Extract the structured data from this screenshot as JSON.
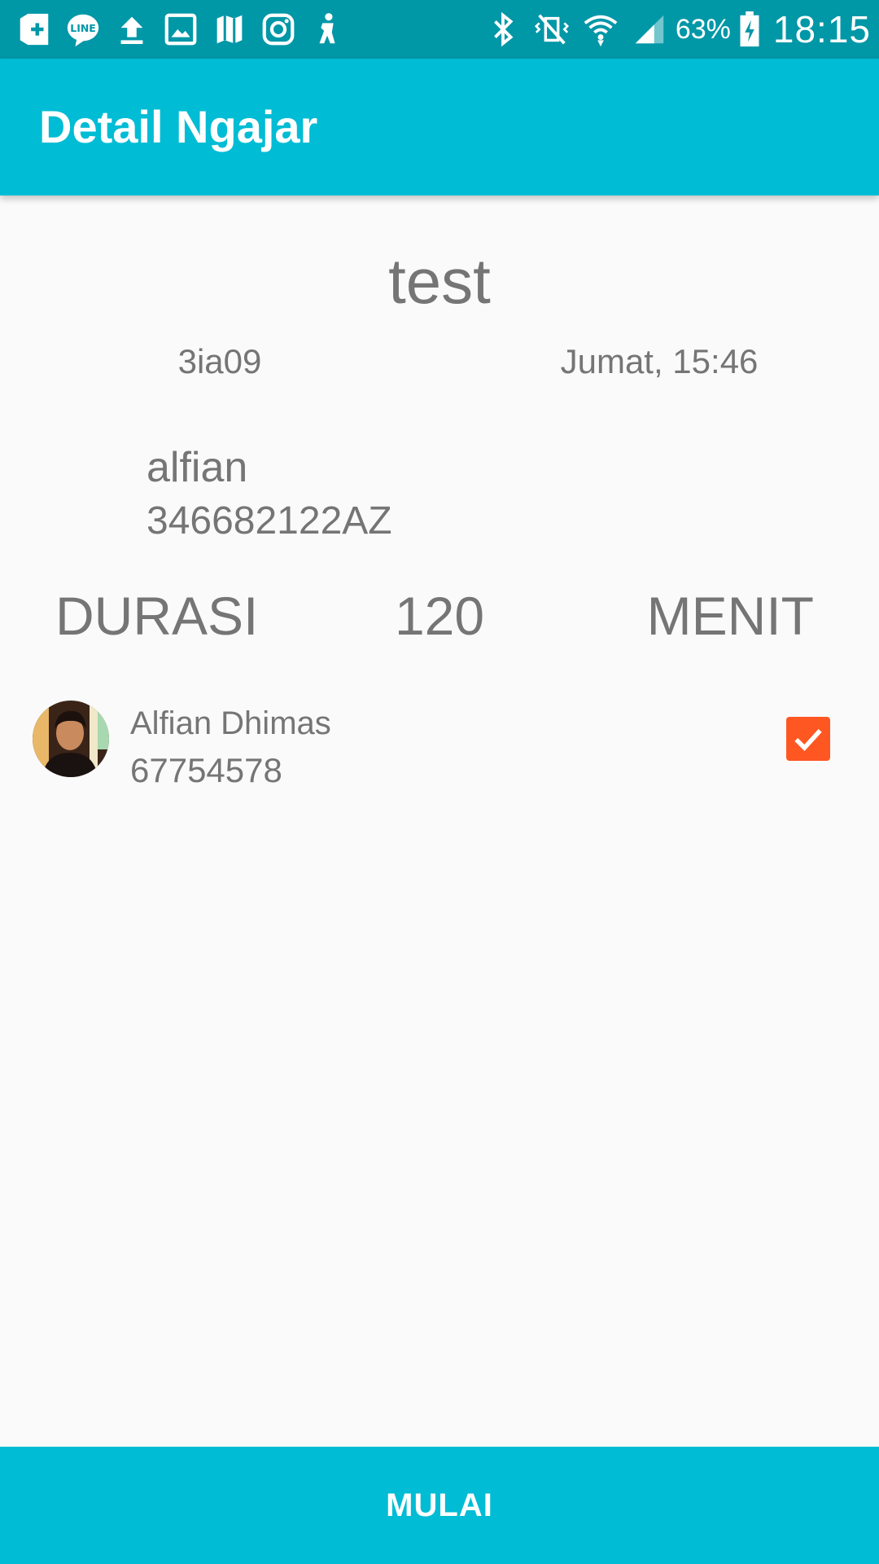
{
  "status_bar": {
    "battery_percent": "63%",
    "time": "18:15",
    "icons_left": [
      "add-box-icon",
      "line-icon",
      "upload-icon",
      "image-icon",
      "map-icon",
      "instagram-icon",
      "accessibility-icon"
    ],
    "icons_right": [
      "bluetooth-icon",
      "vibrate-off-icon",
      "wifi-icon",
      "signal-icon",
      "battery-charging-icon"
    ]
  },
  "app_bar": {
    "title": "Detail Ngajar"
  },
  "course": {
    "title": "test",
    "class_code": "3ia09",
    "schedule": "Jumat, 15:46"
  },
  "lecturer": {
    "name": "alfian",
    "id": "346682122AZ"
  },
  "duration": {
    "label": "DURASI",
    "value": "120",
    "unit": "MENIT"
  },
  "students": [
    {
      "name": "Alfian Dhimas",
      "id": "67754578",
      "checked": true
    }
  ],
  "actions": {
    "start_label": "MULAI"
  },
  "colors": {
    "primary": "#00bcd4",
    "primary_dark": "#0097a7",
    "accent": "#ff5722",
    "text_secondary": "#757575",
    "background": "#fafafa"
  }
}
